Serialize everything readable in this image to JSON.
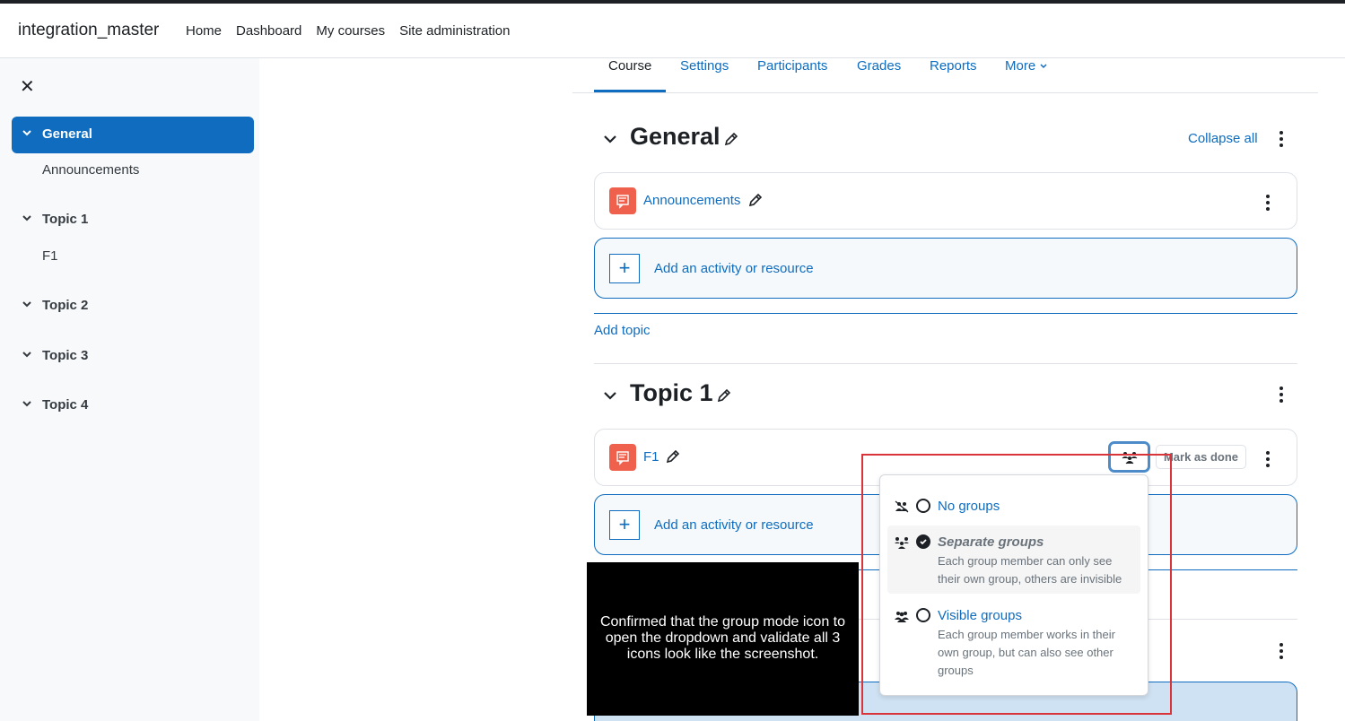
{
  "topbar": {
    "brand": "integration_master",
    "nav": [
      "Home",
      "Dashboard",
      "My courses",
      "Site administration"
    ]
  },
  "drawer": {
    "close_glyph": "✕",
    "items": [
      {
        "label": "General",
        "type": "section",
        "active": true
      },
      {
        "label": "Announcements",
        "type": "activity"
      },
      {
        "label": "Topic 1",
        "type": "section"
      },
      {
        "label": "F1",
        "type": "activity"
      },
      {
        "label": "Topic 2",
        "type": "section"
      },
      {
        "label": "Topic 3",
        "type": "section"
      },
      {
        "label": "Topic 4",
        "type": "section"
      }
    ]
  },
  "tabs": [
    "Course",
    "Settings",
    "Participants",
    "Grades",
    "Reports",
    "More"
  ],
  "sections": {
    "general": {
      "title": "General",
      "collapse_all": "Collapse all",
      "activity": "Announcements",
      "add_activity": "Add an activity or resource",
      "add_topic": "Add topic"
    },
    "topic1": {
      "title": "Topic 1",
      "activity": "F1",
      "mark_done": "Mark as done",
      "add_activity": "Add an activity or resource"
    }
  },
  "group_mode_menu": {
    "options": [
      {
        "title": "No groups",
        "description": "",
        "selected": false,
        "icon": "no-groups-icon"
      },
      {
        "title": "Separate groups",
        "description": "Each group member can only see their own group, others are invisible",
        "selected": true,
        "icon": "separate-groups-icon"
      },
      {
        "title": "Visible groups",
        "description": "Each group member works in their own group, but can also see other groups",
        "selected": false,
        "icon": "visible-groups-icon"
      }
    ]
  },
  "overlay": {
    "text": "Confirmed that the group mode icon to open the dropdown and validate all 3 icons look like the screenshot."
  },
  "colors": {
    "accent": "#0f6cbf",
    "activity_icon": "#f0614d",
    "highlight_box": "#d9343a"
  }
}
